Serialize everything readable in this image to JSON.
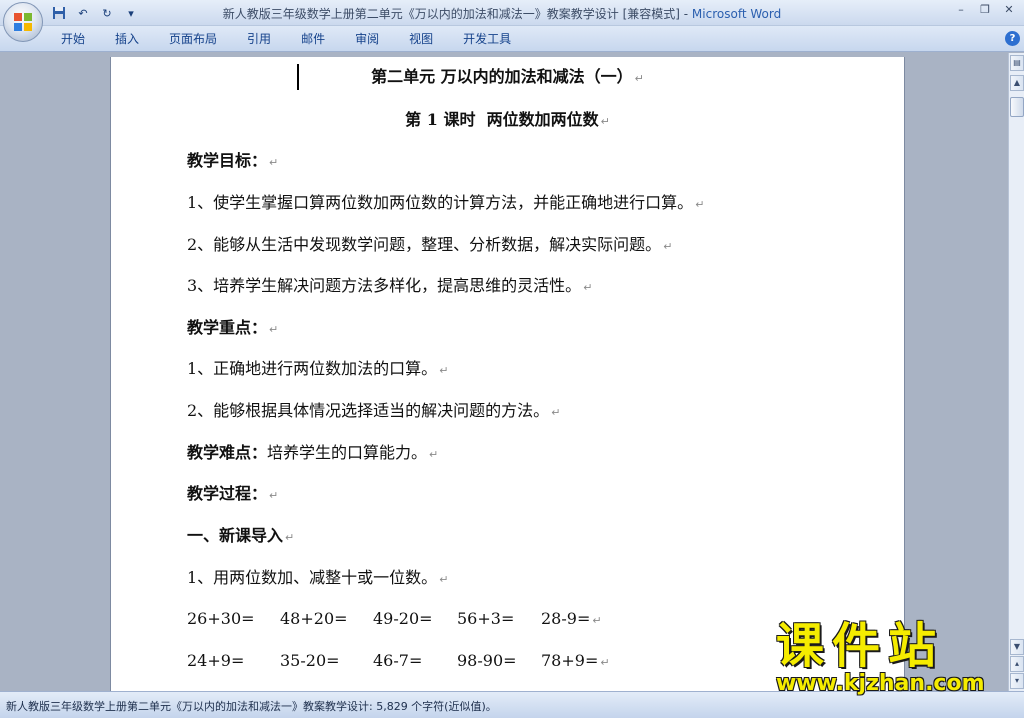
{
  "window": {
    "title_doc": "新人教版三年级数学上册第二单元《万以内的加法和减法一》教案教学设计 [兼容模式] - ",
    "title_app": "Microsoft Word"
  },
  "ribbon": {
    "tabs": [
      "开始",
      "插入",
      "页面布局",
      "引用",
      "邮件",
      "审阅",
      "视图",
      "开发工具"
    ]
  },
  "document": {
    "title": "第二单元 万以内的加法和减法（一）",
    "lesson": "第 1 课时  两位数加两位数",
    "goals_heading": "教学目标：",
    "goals": [
      "1、使学生掌握口算两位数加两位数的计算方法，并能正确地进行口算。",
      "2、能够从生活中发现数学问题，整理、分析数据，解决实际问题。",
      "3、培养学生解决问题方法多样化，提高思维的灵活性。"
    ],
    "key_heading": "教学重点：",
    "key_points": [
      "1、正确地进行两位数加法的口算。",
      "2、能够根据具体情况选择适当的解决问题的方法。"
    ],
    "difficulty_label": "教学难点：",
    "difficulty_text": "培养学生的口算能力。",
    "process_heading": "教学过程：",
    "section1_heading": "一、新课导入",
    "section1_item1": "1、用两位数加、减整十或一位数。",
    "calc_row1": [
      "26+30=",
      "48+20=",
      "49-20=",
      "56+3=",
      "28-9="
    ],
    "calc_row2": [
      "24+9=",
      "35-20=",
      "46-7=",
      "98-90=",
      "78+9="
    ],
    "paragraph_mark": "↵"
  },
  "statusbar": {
    "text": "新人教版三年级数学上册第二单元《万以内的加法和减法一》教案教学设计: 5,829 个字符(近似值)。"
  },
  "watermark": {
    "title": "课件站",
    "url": "www.kjzhan.com"
  }
}
